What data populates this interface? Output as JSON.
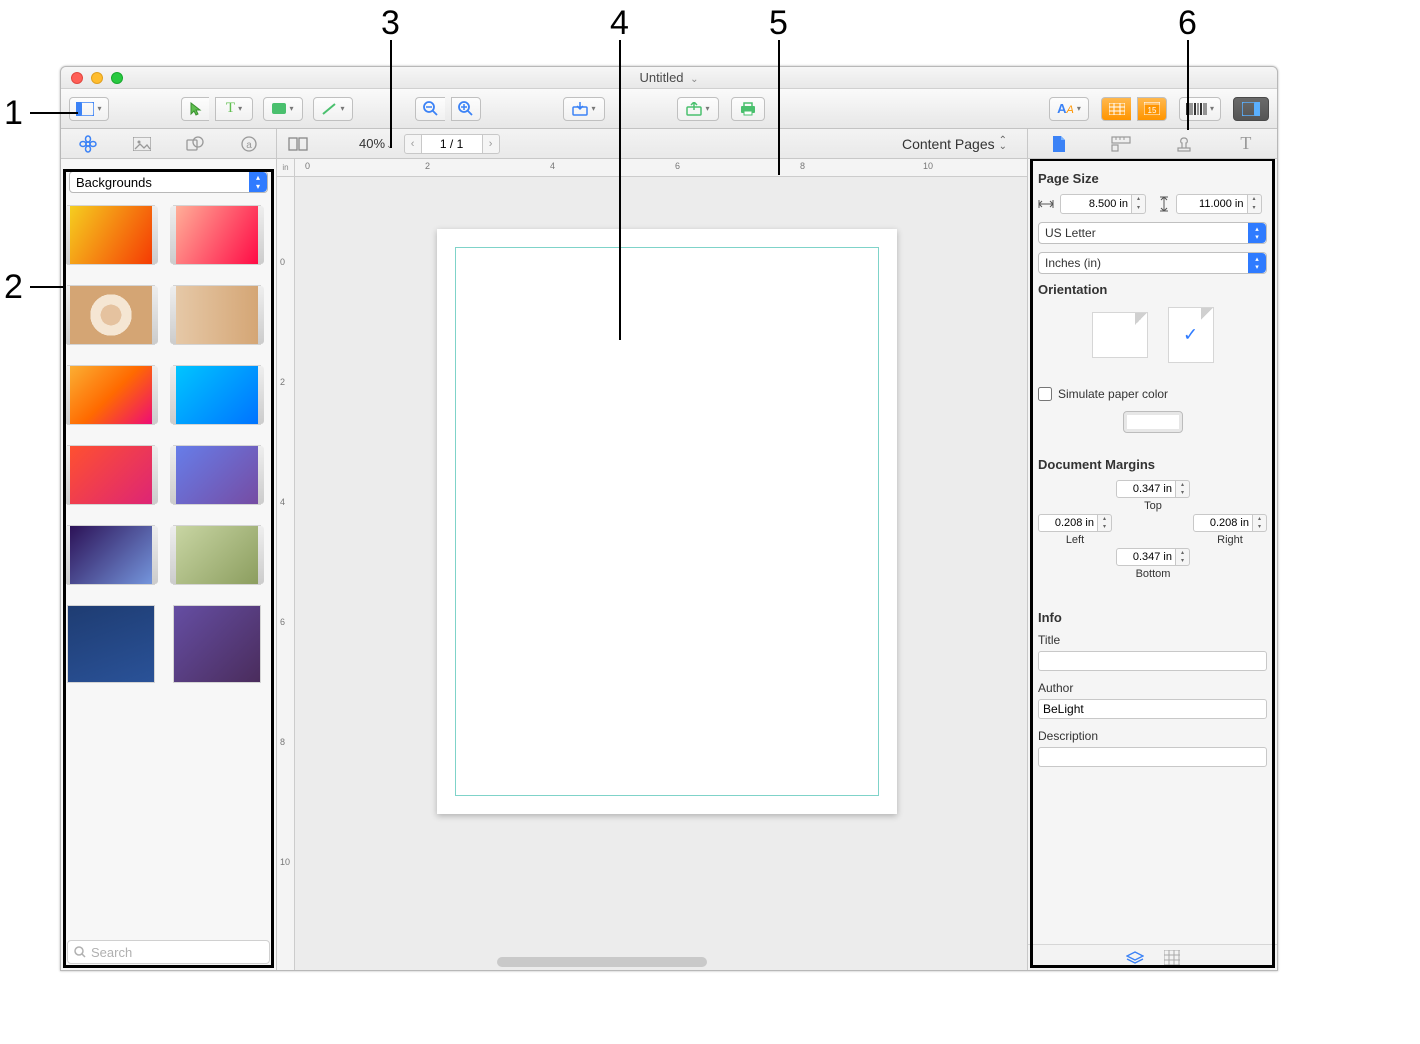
{
  "callouts": {
    "n1": "1",
    "n2": "2",
    "n3": "3",
    "n4": "4",
    "n5": "5",
    "n6": "6"
  },
  "window": {
    "title": "Untitled"
  },
  "subbar": {
    "zoom": "40%",
    "page_current": "1 / 1",
    "content_pages": "Content Pages"
  },
  "source": {
    "category": "Backgrounds",
    "search_placeholder": "Search"
  },
  "ruler": {
    "unit": "in",
    "h": [
      "0",
      "2",
      "4",
      "6",
      "8",
      "10"
    ],
    "v": [
      "0",
      "2",
      "4",
      "6",
      "8",
      "10"
    ]
  },
  "inspector": {
    "page_size_h": "Page Size",
    "width": "8.500 in",
    "height": "11.000 in",
    "preset": "US Letter",
    "units": "Inches (in)",
    "orientation_h": "Orientation",
    "simulate": "Simulate paper color",
    "margins_h": "Document Margins",
    "margin_top": "0.347 in",
    "margin_top_l": "Top",
    "margin_bottom": "0.347 in",
    "margin_bottom_l": "Bottom",
    "margin_left": "0.208 in",
    "margin_left_l": "Left",
    "margin_right": "0.208 in",
    "margin_right_l": "Right",
    "info_h": "Info",
    "title_l": "Title",
    "title_v": "",
    "author_l": "Author",
    "author_v": "BeLight",
    "desc_l": "Description"
  }
}
